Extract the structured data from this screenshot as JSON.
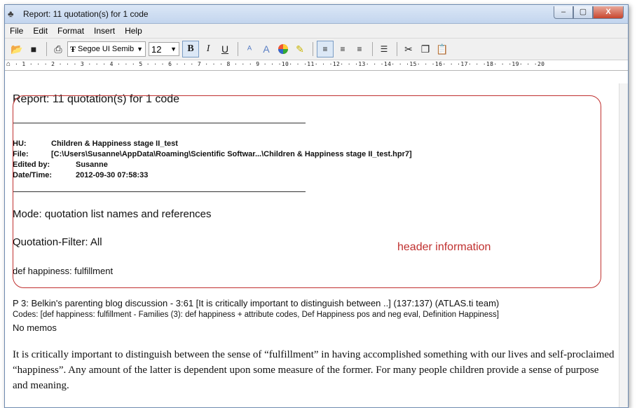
{
  "window": {
    "title": "Report: 11 quotation(s) for 1 code",
    "minimize": "–",
    "maximize": "▢",
    "close": "X"
  },
  "menu": [
    "File",
    "Edit",
    "Format",
    "Insert",
    "Help"
  ],
  "toolbar": {
    "font_name": "Segoe UI Semib",
    "font_size": "12",
    "bold": "B",
    "italic": "I",
    "underline": "U",
    "font_icon": "Ŧ"
  },
  "ruler": {
    "marker": "⌂",
    "text": "· 1 · · · 2 · · · 3 · · · 4 · · · 5 · · · 6 · · · 7 · · · 8 · · · 9 · · ·10· · ·11· · ·12· · ·13· · ·14· · ·15· · ·16· · ·17· · ·18· · ·19· · ·20"
  },
  "report": {
    "heading": "Report: 11 quotation(s) for 1 code",
    "hu_label": "HU:",
    "hu_value": "Children & Happiness stage II_test",
    "file_label": "File:",
    "file_value": "[C:\\Users\\Susanne\\AppData\\Roaming\\Scientific Softwar...\\Children & Happiness stage II_test.hpr7]",
    "edited_label": "Edited by:",
    "edited_value": "Susanne",
    "date_label": "Date/Time:",
    "date_value": "2012-09-30 07:58:33",
    "mode": "Mode: quotation list names and references",
    "filter": "Quotation-Filter: All",
    "code": "def happiness: fulfillment",
    "annotation": "header information"
  },
  "quotation": {
    "title": "P 3: Belkin's parenting blog discussion - 3:61 [It is critically important to distinguish between ..]  (137:137)   (ATLAS.ti team)",
    "codes": "Codes:   [def happiness: fulfillment - Families (3): def happiness + attribute codes, Def Happiness pos and neg eval, Definition Happiness]",
    "memos": "No memos",
    "text": "It is critically important to distinguish between the sense of “fulfillment” in having accomplished something with our lives and self-proclaimed “happiness”. Any amount of the latter is dependent upon some measure of the former. For many people children provide a sense of purpose and meaning."
  }
}
